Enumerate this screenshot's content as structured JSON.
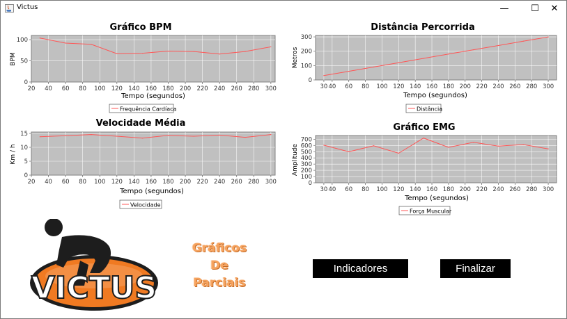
{
  "window": {
    "title": "Victus",
    "minimize_glyph": "—",
    "maximize_glyph": "☐",
    "close_glyph": "✕"
  },
  "colors": {
    "plot_background": "#c0c0c0",
    "series_line": "#ff5555",
    "accent_orange": "#f07a22",
    "button_background": "#000000"
  },
  "charts": [
    {
      "id": "bpm",
      "title": "Gráfico BPM",
      "ylabel": "BPM",
      "xlabel": "Tempo (segundos)",
      "legend": "Frequência Cardíaca"
    },
    {
      "id": "dist",
      "title": "Distância Percorrida",
      "ylabel": "Metros",
      "xlabel": "Tempo (segundos)",
      "legend": "Distância"
    },
    {
      "id": "vel",
      "title": "Velocidade Média",
      "ylabel": "Km / h",
      "xlabel": "Tempo (segundos)",
      "legend": "Velocidade"
    },
    {
      "id": "emg",
      "title": "Gráfico EMG",
      "ylabel": "Amplitude",
      "xlabel": "Tempo (segundos)",
      "legend": "Força Muscular"
    }
  ],
  "chart_data": [
    {
      "type": "line",
      "title": "Gráfico BPM",
      "xlabel": "Tempo (segundos)",
      "ylabel": "BPM",
      "xlim": [
        20,
        305
      ],
      "ylim": [
        0,
        110
      ],
      "xticks": [
        20,
        40,
        60,
        80,
        100,
        120,
        140,
        160,
        180,
        200,
        220,
        240,
        260,
        280,
        300
      ],
      "yticks": [
        0,
        50,
        100
      ],
      "grid": true,
      "legend_position": "bottom",
      "series": [
        {
          "name": "Frequência Cardíaca",
          "x": [
            30,
            60,
            90,
            120,
            150,
            180,
            210,
            240,
            270,
            300
          ],
          "y": [
            104,
            92,
            89,
            67,
            68,
            73,
            72,
            66,
            72,
            83
          ]
        }
      ]
    },
    {
      "type": "line",
      "title": "Distância Percorrida",
      "xlabel": "Tempo (segundos)",
      "ylabel": "Metros",
      "xlim": [
        20,
        310
      ],
      "ylim": [
        0,
        310
      ],
      "xticks": [
        30,
        40,
        60,
        80,
        100,
        120,
        140,
        160,
        180,
        200,
        220,
        240,
        260,
        280,
        300
      ],
      "yticks": [
        0,
        100,
        200,
        300
      ],
      "grid": true,
      "legend_position": "bottom",
      "series": [
        {
          "name": "Distância",
          "x": [
            30,
            60,
            90,
            120,
            150,
            180,
            210,
            240,
            270,
            300
          ],
          "y": [
            30,
            60,
            90,
            120,
            150,
            180,
            210,
            240,
            270,
            300
          ]
        }
      ]
    },
    {
      "type": "line",
      "title": "Velocidade Média",
      "xlabel": "Tempo (segundos)",
      "ylabel": "Km / h",
      "xlim": [
        20,
        305
      ],
      "ylim": [
        0,
        15.5
      ],
      "xticks": [
        20,
        40,
        60,
        80,
        100,
        120,
        140,
        160,
        180,
        200,
        220,
        240,
        260,
        280,
        300
      ],
      "yticks": [
        0,
        5,
        10,
        15
      ],
      "grid": true,
      "legend_position": "bottom",
      "series": [
        {
          "name": "Velocidade",
          "x": [
            30,
            60,
            90,
            120,
            150,
            180,
            210,
            240,
            270,
            300
          ],
          "y": [
            13.8,
            14.2,
            14.6,
            14.0,
            13.3,
            14.3,
            14.0,
            14.4,
            13.6,
            14.6
          ]
        }
      ]
    },
    {
      "type": "line",
      "title": "Gráfico EMG",
      "xlabel": "Tempo (segundos)",
      "ylabel": "Amplitude",
      "xlim": [
        20,
        310
      ],
      "ylim": [
        0,
        760
      ],
      "xticks": [
        30,
        40,
        60,
        80,
        100,
        120,
        140,
        160,
        180,
        200,
        220,
        240,
        260,
        280,
        300
      ],
      "yticks": [
        0,
        100,
        200,
        300,
        400,
        500,
        600,
        700
      ],
      "grid": true,
      "legend_position": "bottom",
      "series": [
        {
          "name": "Força Muscular",
          "x": [
            30,
            60,
            90,
            120,
            150,
            180,
            210,
            240,
            270,
            300
          ],
          "y": [
            605,
            500,
            595,
            475,
            720,
            570,
            650,
            590,
            615,
            545
          ]
        }
      ]
    }
  ],
  "logo": {
    "text": "VICTUS"
  },
  "parciais": {
    "line1": "Gráficos",
    "line2": "De",
    "line3": "Parciais"
  },
  "buttons": {
    "indicadores": "Indicadores",
    "finalizar": "Finalizar"
  }
}
